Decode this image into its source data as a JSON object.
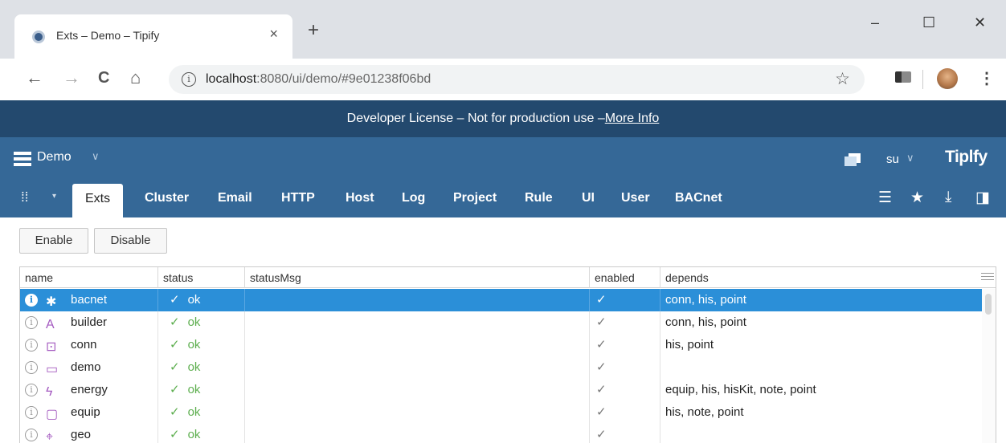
{
  "browser": {
    "tab_title": "Exts – Demo – Tipify",
    "tab_close": "×",
    "new_tab": "+",
    "window_buttons": [
      "–",
      "☐",
      "✕"
    ],
    "url_host": "localhost",
    "url_rest": ":8080/ui/demo/#9e01238f06bd",
    "info_glyph": "i",
    "star_glyph": "☆",
    "nav_glyphs": {
      "back": "←",
      "forward": "→",
      "reload": "C",
      "home": "⌂"
    },
    "menu_glyph": "⋮"
  },
  "banner": {
    "text": "Developer License – Not for production use –",
    "link": "More Info"
  },
  "appbar": {
    "project": "Demo",
    "chevron": "∨",
    "user": "su",
    "brand": "Tiplfy"
  },
  "tabbar": {
    "app_menu_glyph": "⁞⁞",
    "caret": "▾",
    "tabs": [
      "Exts",
      "Cluster",
      "Email",
      "HTTP",
      "Host",
      "Log",
      "Project",
      "Rule",
      "UI",
      "User",
      "BACnet"
    ],
    "right_icons": {
      "list": "☰",
      "star": "★",
      "download": "⤓",
      "panel": "◨"
    }
  },
  "actions": {
    "enable": "Enable",
    "disable": "Disable"
  },
  "grid": {
    "columns": [
      "name",
      "status",
      "statusMsg",
      "enabled",
      "depends"
    ],
    "rows": [
      {
        "icon": "puzzle-icon",
        "glyph": "✱",
        "name": "bacnet",
        "status": "ok",
        "statusMsg": "",
        "enabled": "✓",
        "depends": "conn, his, point",
        "selected": true
      },
      {
        "icon": "builder-icon",
        "glyph": "A",
        "name": "builder",
        "status": "ok",
        "statusMsg": "",
        "enabled": "✓",
        "depends": "conn, his, point",
        "selected": false
      },
      {
        "icon": "plug-icon",
        "glyph": "⊡",
        "name": "conn",
        "status": "ok",
        "statusMsg": "",
        "enabled": "✓",
        "depends": "his, point",
        "selected": false
      },
      {
        "icon": "presentation-icon",
        "glyph": "▭",
        "name": "demo",
        "status": "ok",
        "statusMsg": "",
        "enabled": "✓",
        "depends": "",
        "selected": false
      },
      {
        "icon": "lightning-icon",
        "glyph": "ϟ",
        "name": "energy",
        "status": "ok",
        "statusMsg": "",
        "enabled": "✓",
        "depends": "equip, his, hisKit, note, point",
        "selected": false
      },
      {
        "icon": "monitor-icon",
        "glyph": "▢",
        "name": "equip",
        "status": "ok",
        "statusMsg": "",
        "enabled": "✓",
        "depends": "his, note, point",
        "selected": false
      },
      {
        "icon": "geo-icon",
        "glyph": "⌖",
        "name": "geo",
        "status": "ok",
        "statusMsg": "",
        "enabled": "✓",
        "depends": "",
        "selected": false
      }
    ],
    "check_glyph": "✓"
  },
  "colors": {
    "banner": "#23496e",
    "appbar": "#356897",
    "selection": "#2b8fd8",
    "ok": "#5cae4e",
    "ext_icon": "#a45ac0"
  }
}
